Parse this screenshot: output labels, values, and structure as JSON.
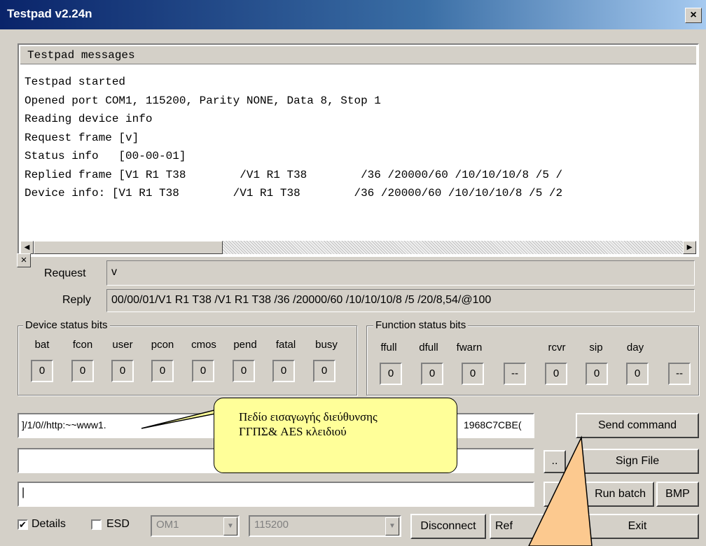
{
  "window": {
    "title": "Testpad v2.24n",
    "close_glyph": "×"
  },
  "messages": {
    "header": "Testpad messages",
    "lines": [
      "Testpad started",
      "Opened port COM1, 115200, Parity NONE, Data 8, Stop 1",
      "Reading device info",
      "Request frame [v]",
      "Status info   [00-00-01]",
      "Replied frame [V1 R1 T38        /V1 R1 T38        /36 /20000/60 /10/10/10/8 /5 /",
      "Device info: [V1 R1 T38        /V1 R1 T38        /36 /20000/60 /10/10/10/8 /5 /2"
    ]
  },
  "request": {
    "label": "Request",
    "value": "v"
  },
  "reply": {
    "label": "Reply",
    "value": "00/00/01/V1 R1 T38        /V1 R1 T38        /36 /20000/60 /10/10/10/8 /5 /20/8,54/@100"
  },
  "device_status": {
    "title": "Device status bits",
    "labels": [
      "bat",
      "fcon",
      "user",
      "pcon",
      "cmos",
      "pend",
      "fatal",
      "busy"
    ],
    "values": [
      "0",
      "0",
      "0",
      "0",
      "0",
      "0",
      "0",
      "0"
    ]
  },
  "function_status": {
    "title": "Function status bits",
    "labels": [
      "ffull",
      "dfull",
      "fwarn",
      "",
      "rcvr",
      "sip",
      "day",
      ""
    ],
    "values": [
      "0",
      "0",
      "0",
      "--",
      "0",
      "0",
      "0",
      "--"
    ]
  },
  "command_input": {
    "left_text": "]/1/0//http:~~www1.",
    "right_text": "1968C7CBE("
  },
  "file_input": {
    "value": ""
  },
  "batch_input": {
    "value": "|"
  },
  "buttons": {
    "send_command": "Send command",
    "browse": "..",
    "sign_file": "Sign File",
    "run_batch": "Run batch",
    "run_batch_visible": "Run batch",
    "bmp": "BMP",
    "disconnect": "Disconnect",
    "refresh": "Refresh",
    "refresh_visible": "Ref",
    "exit": "Exit"
  },
  "bottom": {
    "details_label": "Details",
    "details_checked": true,
    "esd_label": "ESD",
    "esd_checked": false,
    "port": "OM1",
    "baud": "115200"
  },
  "callout": {
    "line1": "Πεδίο εισαγωγής διεύθυνσης",
    "line2": "ΓΓΠΣ& AES κλειδιού"
  }
}
